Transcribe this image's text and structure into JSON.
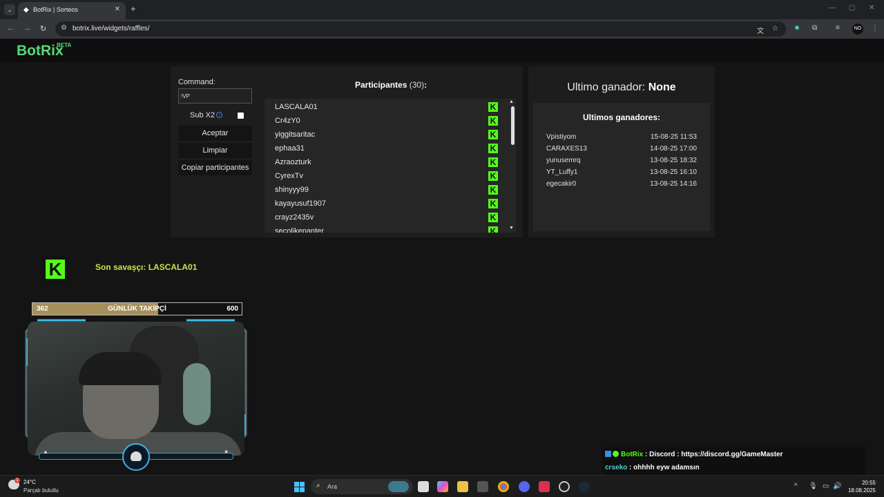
{
  "browser": {
    "tab_title": "BotRix | Sorteos",
    "url": "botrix.live/widgets/raffles/",
    "profile_initials": "NO"
  },
  "site": {
    "logo": "BotRix",
    "logo_badge": "BETA"
  },
  "raffle_controls": {
    "command_label": "Command:",
    "command_value": "!VP",
    "subx2_label": "Sub X2",
    "accept_label": "Aceptar",
    "clear_label": "Limpiar",
    "copy_label": "Copiar participantes"
  },
  "participants": {
    "title": "Participantes",
    "count": "(30)",
    "colon": ":",
    "items": [
      "LASCALA01",
      "Cr4zY0",
      "yiggitsaritac",
      "ephaa31",
      "Azraozturk",
      "CyrexTv",
      "shinyyy99",
      "kayayusuf1907",
      "crayz2435v",
      "secolikepanter"
    ],
    "badge_letter": "K"
  },
  "winners": {
    "last_winner_label": "Ultimo ganador:",
    "last_winner_value": "None",
    "list_title": "Ultimos ganadores:",
    "items": [
      {
        "name": "Vpistiyom",
        "date": "15-08-25 11:53"
      },
      {
        "name": "CARAXES13",
        "date": "14-08-25 17:00"
      },
      {
        "name": "yunusemrq",
        "date": "13-08-25 18:32"
      },
      {
        "name": "YT_Luffy1",
        "date": "13-08-25 16:10"
      },
      {
        "name": "egecakir0",
        "date": "13-08-25 14:16"
      }
    ]
  },
  "overlay": {
    "kick_letter": "K",
    "last_warrior": "Son savaşçı: LASCALA01",
    "follower_goal": {
      "current": "362",
      "label": "GÜNLÜK TAKİPÇİ",
      "target": "600",
      "progress_fraction": 0.6
    }
  },
  "chat": [
    {
      "user": "BotRix",
      "message": ": Discord : https://discord.gg/GameMaster"
    },
    {
      "user": "crseko",
      "message": ": ohhhh eyw adamsın"
    }
  ],
  "taskbar": {
    "temperature": "24°C",
    "weather": "Parçalı bulutlu",
    "weather_badge": "1",
    "search_placeholder": "Ara",
    "time": "20:55",
    "date": "18.08.2025"
  },
  "colors": {
    "brand_green": "#57d977",
    "kick_green": "#53fc18",
    "overlay_text": "#c9e54a",
    "goal_fill": "#a68f5a"
  }
}
